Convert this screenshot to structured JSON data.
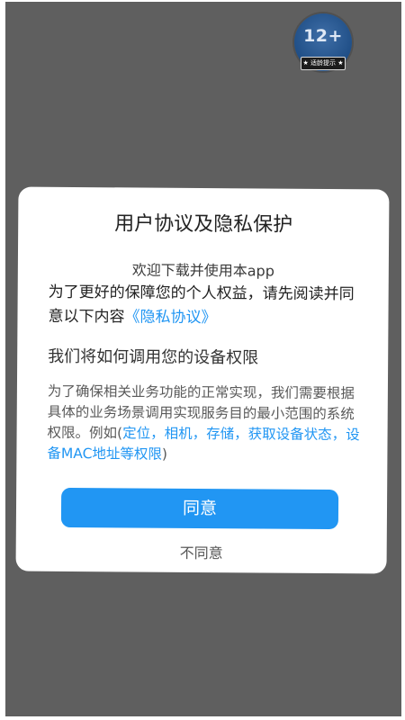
{
  "badge": {
    "age": "12+",
    "caption": "★ 适龄提示 ★"
  },
  "dialog": {
    "title": "用户协议及隐私保护",
    "welcome": "欢迎下载并使用本app",
    "intro_text": "为了更好的保障您的个人权益，请先阅读并同意以下内容",
    "privacy_link": "《隐私协议》",
    "permissions_title": "我们将如何调用您的设备权限",
    "permissions_text": "为了确保相关业务功能的正常实现，我们需要根据具体的业务场景调用实现服务目的最小范围的系统权限。例如(",
    "permissions_examples": "定位，相机，存储，获取设备状态，设备MAC地址等权限",
    "permissions_close": ")",
    "agree_label": "同意",
    "disagree_label": "不同意"
  },
  "colors": {
    "overlay": "#5f5f5f",
    "accent": "#2196f3",
    "badge": "#1f4e86"
  }
}
